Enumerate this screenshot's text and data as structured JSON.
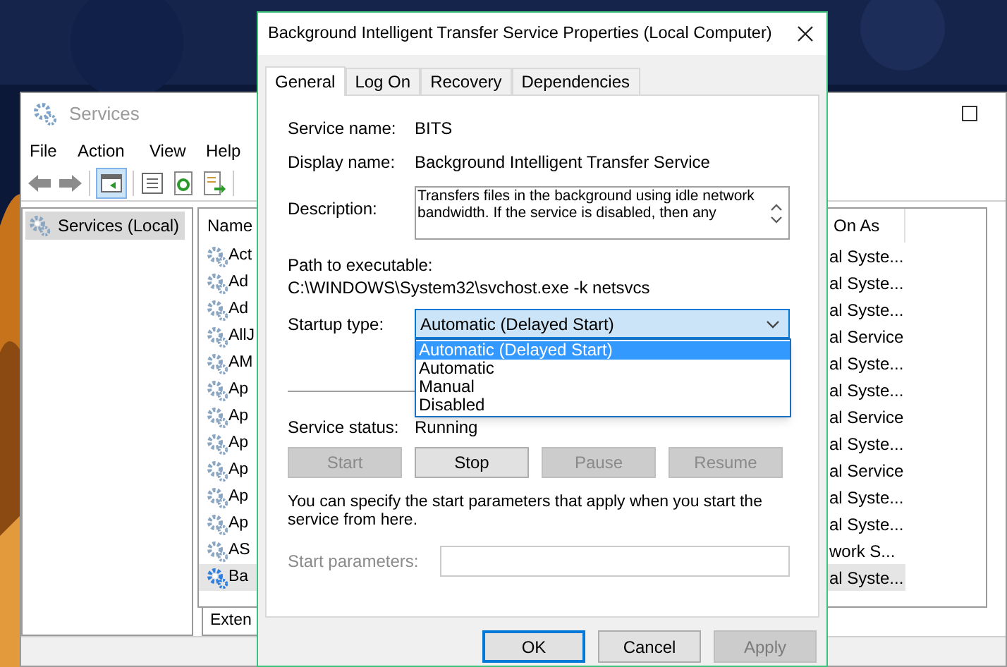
{
  "services_window": {
    "title": "Services",
    "menu": [
      "File",
      "Action",
      "View",
      "Help"
    ],
    "tree": [
      {
        "label": "Services (Local)",
        "selected": true
      }
    ],
    "columns": {
      "name": "Name",
      "log_on_as": "On As"
    },
    "rows": [
      {
        "name": "Act",
        "log_on_as": "al Syste...",
        "selected": false
      },
      {
        "name": "Ad",
        "log_on_as": "al Syste...",
        "selected": false
      },
      {
        "name": "Ad",
        "log_on_as": "al Syste...",
        "selected": false
      },
      {
        "name": "AllJ",
        "log_on_as": "al Service",
        "selected": false
      },
      {
        "name": "AM",
        "log_on_as": "al Syste...",
        "selected": false
      },
      {
        "name": "Ap",
        "log_on_as": "al Syste...",
        "selected": false
      },
      {
        "name": "Ap",
        "log_on_as": "al Service",
        "selected": false
      },
      {
        "name": "Ap",
        "log_on_as": "al Syste...",
        "selected": false
      },
      {
        "name": "Ap",
        "log_on_as": "al Service",
        "selected": false
      },
      {
        "name": "Ap",
        "log_on_as": "al Syste...",
        "selected": false
      },
      {
        "name": "Ap",
        "log_on_as": "al Syste...",
        "selected": false
      },
      {
        "name": "AS",
        "log_on_as": "work S...",
        "selected": false
      },
      {
        "name": "Ba",
        "log_on_as": "al Syste...",
        "selected": true
      }
    ],
    "view_tabs": [
      {
        "label": "Exten",
        "selected": true
      }
    ]
  },
  "dialog": {
    "title": "Background Intelligent Transfer Service Properties (Local Computer)",
    "tabs": [
      {
        "label": "General",
        "selected": true
      },
      {
        "label": "Log On",
        "selected": false
      },
      {
        "label": "Recovery",
        "selected": false
      },
      {
        "label": "Dependencies",
        "selected": false
      }
    ],
    "service_name": {
      "label": "Service name:",
      "value": "BITS"
    },
    "display_name": {
      "label": "Display name:",
      "value": "Background Intelligent Transfer Service"
    },
    "description": {
      "label": "Description:",
      "value": "Transfers files in the background using idle network bandwidth. If the service is disabled, then any"
    },
    "path": {
      "label": "Path to executable:",
      "value": "C:\\WINDOWS\\System32\\svchost.exe -k netsvcs"
    },
    "startup_type": {
      "label": "Startup type:",
      "value": "Automatic (Delayed Start)",
      "expanded": true,
      "options": [
        {
          "label": "Automatic (Delayed Start)",
          "selected": true
        },
        {
          "label": "Automatic",
          "selected": false
        },
        {
          "label": "Manual",
          "selected": false
        },
        {
          "label": "Disabled",
          "selected": false
        }
      ]
    },
    "service_status": {
      "label": "Service status:",
      "value": "Running"
    },
    "service_buttons": [
      {
        "label": "Start",
        "disabled": true
      },
      {
        "label": "Stop",
        "disabled": false
      },
      {
        "label": "Pause",
        "disabled": true
      },
      {
        "label": "Resume",
        "disabled": true
      }
    ],
    "hint": "You can specify the start parameters that apply when you start the service from here.",
    "start_parameters": {
      "label": "Start parameters:",
      "disabled": true
    },
    "buttons": [
      {
        "label": "OK",
        "default": true,
        "disabled": false
      },
      {
        "label": "Cancel",
        "default": false,
        "disabled": false
      },
      {
        "label": "Apply",
        "default": false,
        "disabled": true
      }
    ]
  }
}
